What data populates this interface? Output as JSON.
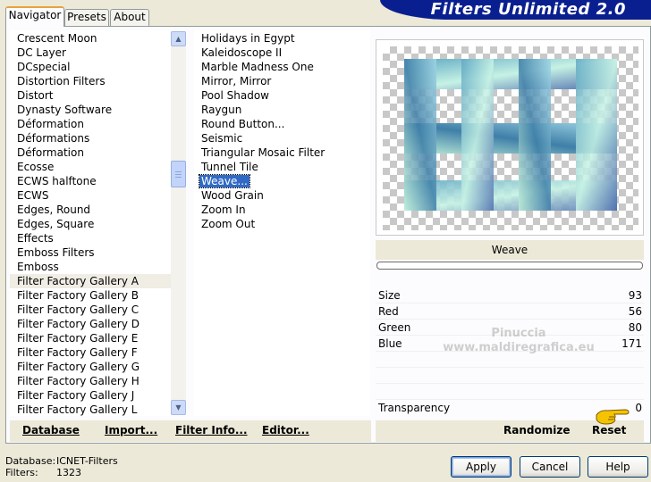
{
  "tabs": [
    "Navigator",
    "Presets",
    "About"
  ],
  "title": "Filters Unlimited 2.0",
  "categories": [
    "Crescent Moon",
    "DC Layer",
    "DCspecial",
    "Distortion Filters",
    "Distort",
    "Dynasty Software",
    "Déformation",
    "Déformations",
    "Déformation",
    "Ecosse",
    "ECWS halftone",
    "ECWS",
    "Edges, Round",
    "Edges, Square",
    "Effects",
    "Emboss Filters",
    "Emboss",
    "Filter Factory Gallery A",
    "Filter Factory Gallery B",
    "Filter Factory Gallery C",
    "Filter Factory Gallery D",
    "Filter Factory Gallery E",
    "Filter Factory Gallery F",
    "Filter Factory Gallery G",
    "Filter Factory Gallery H",
    "Filter Factory Gallery J",
    "Filter Factory Gallery L"
  ],
  "selected_category": "Filter Factory Gallery A",
  "filters": [
    "Holidays in Egypt",
    "Kaleidoscope II",
    "Marble Madness One",
    "Mirror, Mirror",
    "Pool Shadow",
    "Raygun",
    "Round Button...",
    "Seismic",
    "Triangular Mosaic Filter",
    "Tunnel Tile",
    "Weave...",
    "Wood Grain",
    "Zoom In",
    "Zoom Out"
  ],
  "selected_filter": "Weave...",
  "preview_filter_name": "Weave",
  "params": [
    {
      "label": "Size",
      "value": "93"
    },
    {
      "label": "Red",
      "value": "56"
    },
    {
      "label": "Green",
      "value": "80"
    },
    {
      "label": "Blue",
      "value": "171"
    }
  ],
  "transparency": {
    "label": "Transparency",
    "value": "0"
  },
  "watermark": {
    "line1": "Pinuccia",
    "line2": "www.maldiregrafica.eu"
  },
  "left_links": [
    "Database",
    "Import...",
    "Filter Info...",
    "Editor..."
  ],
  "right_links": [
    "Randomize",
    "Reset"
  ],
  "footer": {
    "database_label": "Database:",
    "database_value": "ICNET-Filters",
    "filters_label": "Filters:",
    "filters_value": "1323"
  },
  "buttons": {
    "apply": "Apply",
    "cancel": "Cancel",
    "help": "Help"
  },
  "colors": {
    "banner": "#0a1f8f",
    "selection": "#316ac5"
  }
}
